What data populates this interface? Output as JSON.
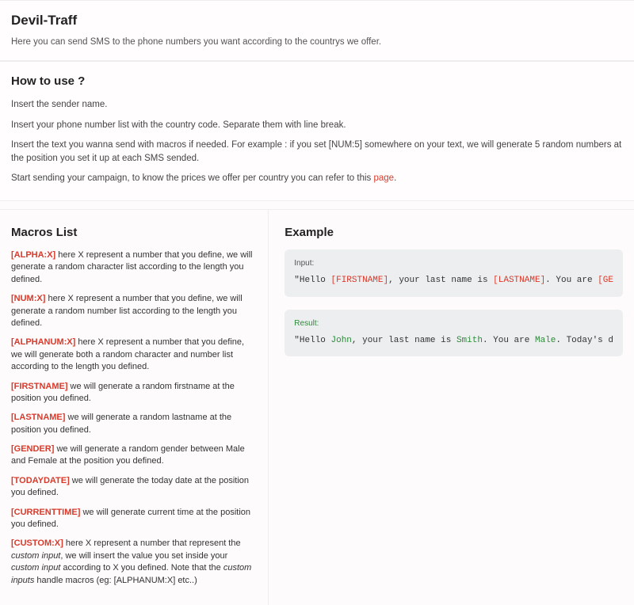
{
  "header": {
    "title": "Devil-Traff",
    "subtitle": "Here you can send SMS to the phone numbers you want according to the countrys we offer."
  },
  "howto": {
    "title": "How to use ?",
    "steps": [
      "Insert the sender name.",
      "Insert your phone number list with the country code. Separate them with line break.",
      "Insert the text you wanna send with macros if needed. For example : if you set [NUM:5] somewhere on your text, we will generate 5 random numbers at the position you set it up at each SMS sended."
    ],
    "last_prefix": "Start sending your campaign, to know the prices we offer per country you can refer to this ",
    "last_link": "page",
    "last_suffix": "."
  },
  "macros": {
    "title": "Macros List",
    "items": [
      {
        "tag": "[ALPHA:X]",
        "desc": " here X represent a number that you define, we will generate a random character list according to the length you defined."
      },
      {
        "tag": "[NUM:X]",
        "desc": " here X represent a number that you define, we will generate a random number list according to the length you defined."
      },
      {
        "tag": "[ALPHANUM:X]",
        "desc": " here X represent a number that you define, we will generate both a random character and number list according to the length you defined."
      },
      {
        "tag": "[FIRSTNAME]",
        "desc": " we will generate a random firstname at the position you defined."
      },
      {
        "tag": "[LASTNAME]",
        "desc": " we will generate a random lastname at the position you defined."
      },
      {
        "tag": "[GENDER]",
        "desc": " we will generate a random gender between Male and Female at the position you defined."
      },
      {
        "tag": "[TODAYDATE]",
        "desc": " we will generate the today date at the position you defined."
      },
      {
        "tag": "[CURRENTTIME]",
        "desc": " we will generate current time at the position you defined."
      }
    ],
    "custom": {
      "tag": "[CUSTOM:X]",
      "p1": " here X represent a number that represent the ",
      "i1": "custom input",
      "p2": ", we will insert the value you set inside your ",
      "i2": "custom input",
      "p3": " according to X you defined. Note that the ",
      "i3": "custom inputs",
      "p4": " handle macros (eg: [ALPHANUM:X] etc..)"
    }
  },
  "example": {
    "title": "Example",
    "input_label": "Input:",
    "result_label": "Result:",
    "input": {
      "t1": "\"Hello ",
      "m1": "[FIRSTNAME]",
      "t2": ", your last name is ",
      "m2": "[LASTNAME]",
      "t3": ". You are ",
      "m3": "[GE"
    },
    "result": {
      "t1": "\"Hello ",
      "v1": "John",
      "t2": ", your last name is ",
      "v2": "Smith",
      "t3": ". You are ",
      "v3": "Male",
      "t4": ". Today's d"
    }
  }
}
